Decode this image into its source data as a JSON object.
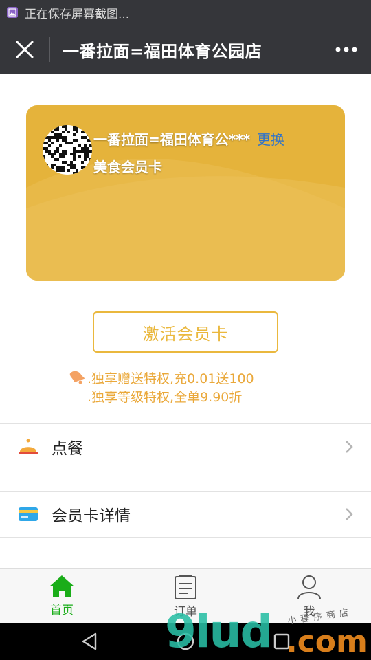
{
  "status_bar": {
    "text": "正在保存屏幕截图...",
    "icon": "screenshot-icon"
  },
  "title_bar": {
    "title": "一番拉面=福田体育公园店",
    "close_icon": "close-icon",
    "more_icon": "more-dots-icon"
  },
  "card": {
    "store_name": "一番拉面=福田体育公***",
    "change_label": "更换",
    "card_type": "美食会员卡",
    "background_color": "#e5b33b",
    "change_color": "#2f73c9"
  },
  "activate_button": {
    "label": "激活会员卡",
    "color": "#eab83e"
  },
  "perks": {
    "icon": "bell-icon",
    "items": [
      ".独享赠送特权,充0.01送100",
      ".独享等级特权,全单9.90折"
    ],
    "color": "#eaa83a"
  },
  "menu": [
    {
      "label": "点餐",
      "icon": "dining-bell-icon"
    },
    {
      "label": "会员卡详情",
      "icon": "card-icon"
    }
  ],
  "tabs": [
    {
      "label": "首页",
      "icon": "home-icon",
      "active": true
    },
    {
      "label": "订单",
      "icon": "order-list-icon",
      "active": false
    },
    {
      "label": "我",
      "icon": "user-icon",
      "active": false
    }
  ],
  "tab_colors": {
    "active": "#1aad19",
    "inactive": "#555555"
  },
  "nav_bar": {
    "buttons": [
      "back-icon",
      "home-circle-icon",
      "recents-icon"
    ]
  },
  "watermark": {
    "main": "9lud",
    "suffix": ".com",
    "small": "小程序商店"
  }
}
